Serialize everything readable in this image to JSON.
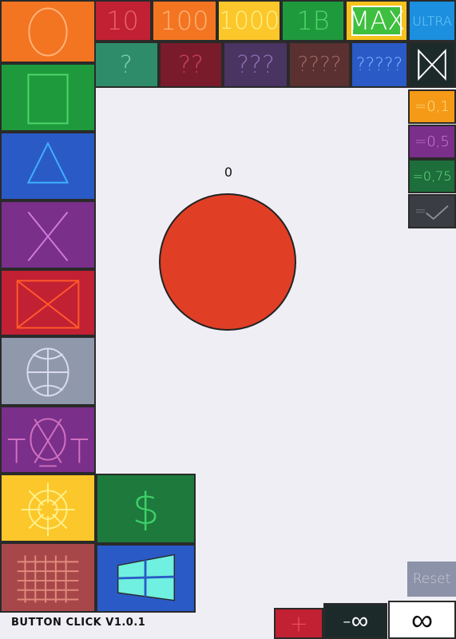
{
  "app": {
    "title": "BUTTON CLICK V1.0.1"
  },
  "counter": {
    "value": "0"
  },
  "big_button": {
    "color": "#e03f26"
  },
  "top_row": [
    {
      "label": "10",
      "color": "#c22033",
      "text_color": "#e9636b"
    },
    {
      "label": "100",
      "color": "#f37521",
      "text_color": "#ffb27a"
    },
    {
      "label": "1000",
      "color": "#fcc72a",
      "text_color": "#fff08a"
    },
    {
      "label": "1B",
      "color": "#1e9a3c",
      "text_color": "#4fd46b"
    },
    {
      "label": "MAX",
      "color": "#f6c21b",
      "text_color": "#ffffff"
    },
    {
      "label": "ULTRA",
      "color": "#1c8fde",
      "text_color": "#7ad0ff"
    }
  ],
  "second_row": [
    {
      "label": "?",
      "color": "#2f8c6a",
      "text_color": "#7fd1b0"
    },
    {
      "label": "??",
      "color": "#7a1b2c",
      "text_color": "#c8425a"
    },
    {
      "label": "???",
      "color": "#4a3462",
      "text_color": "#8f6fb3"
    },
    {
      "label": "????",
      "color": "#5a3030",
      "text_color": "#a36a6a"
    },
    {
      "label": "?????",
      "color": "#2a5ac6",
      "text_color": "#7fb4ff"
    },
    {
      "label": "bowtie-icon",
      "color": "#1d2a2a",
      "text_color": "#ffffff"
    }
  ],
  "right_column": [
    {
      "label": "=0,1",
      "color": "#f59a17",
      "text_color": "#ffe08a"
    },
    {
      "label": "=0,5",
      "color": "#7a2f8a",
      "text_color": "#d07ae0"
    },
    {
      "label": "=0,75",
      "color": "#1d6e3a",
      "text_color": "#6fe08a"
    },
    {
      "label": "=",
      "color": "#3a3d44",
      "text_color": "#8c9099"
    }
  ],
  "left_column": [
    {
      "icon": "circle-icon",
      "color": "#f37521",
      "stroke": "#ffb27a"
    },
    {
      "icon": "square-icon",
      "color": "#1e9a3c",
      "stroke": "#4fd46b"
    },
    {
      "icon": "triangle-icon",
      "color": "#2a5ac6",
      "stroke": "#3fb0ff"
    },
    {
      "icon": "x-icon",
      "color": "#7a2f8a",
      "stroke": "#d07ae0"
    },
    {
      "icon": "crossed-box-icon",
      "color": "#c22033",
      "stroke": "#ff5a2a"
    },
    {
      "icon": "wheel-icon",
      "color": "#9098ac",
      "stroke": "#d8dcec"
    },
    {
      "icon": "txt-icon",
      "color": "#7a2f8a",
      "stroke": "#d070c0"
    },
    {
      "icon": "sun-wheel-icon",
      "color": "#fcc72a",
      "stroke": "#fff08a"
    },
    {
      "icon": "grid-icon",
      "color": "#a8474a",
      "stroke": "#e08a7a"
    }
  ],
  "shop": {
    "dollar_label": "$",
    "dollar_color": "#1d7a3c",
    "dollar_text": "#3fd06a",
    "windows_color": "#2a5ac6",
    "windows_pane": "#6ff0e0"
  },
  "reset": {
    "label": "Reset",
    "color": "#8c93a8",
    "text_color": "#c8ccd8"
  },
  "bottom_bar": {
    "plus": {
      "label": "+",
      "color": "#c22033",
      "text_color": "#f0505a"
    },
    "minus_inf": {
      "label": "-∞",
      "color": "#1d2a2a",
      "text_color": "#ffffff"
    },
    "inf": {
      "label": "∞",
      "color": "#ffffff",
      "text_color": "#111111"
    }
  }
}
